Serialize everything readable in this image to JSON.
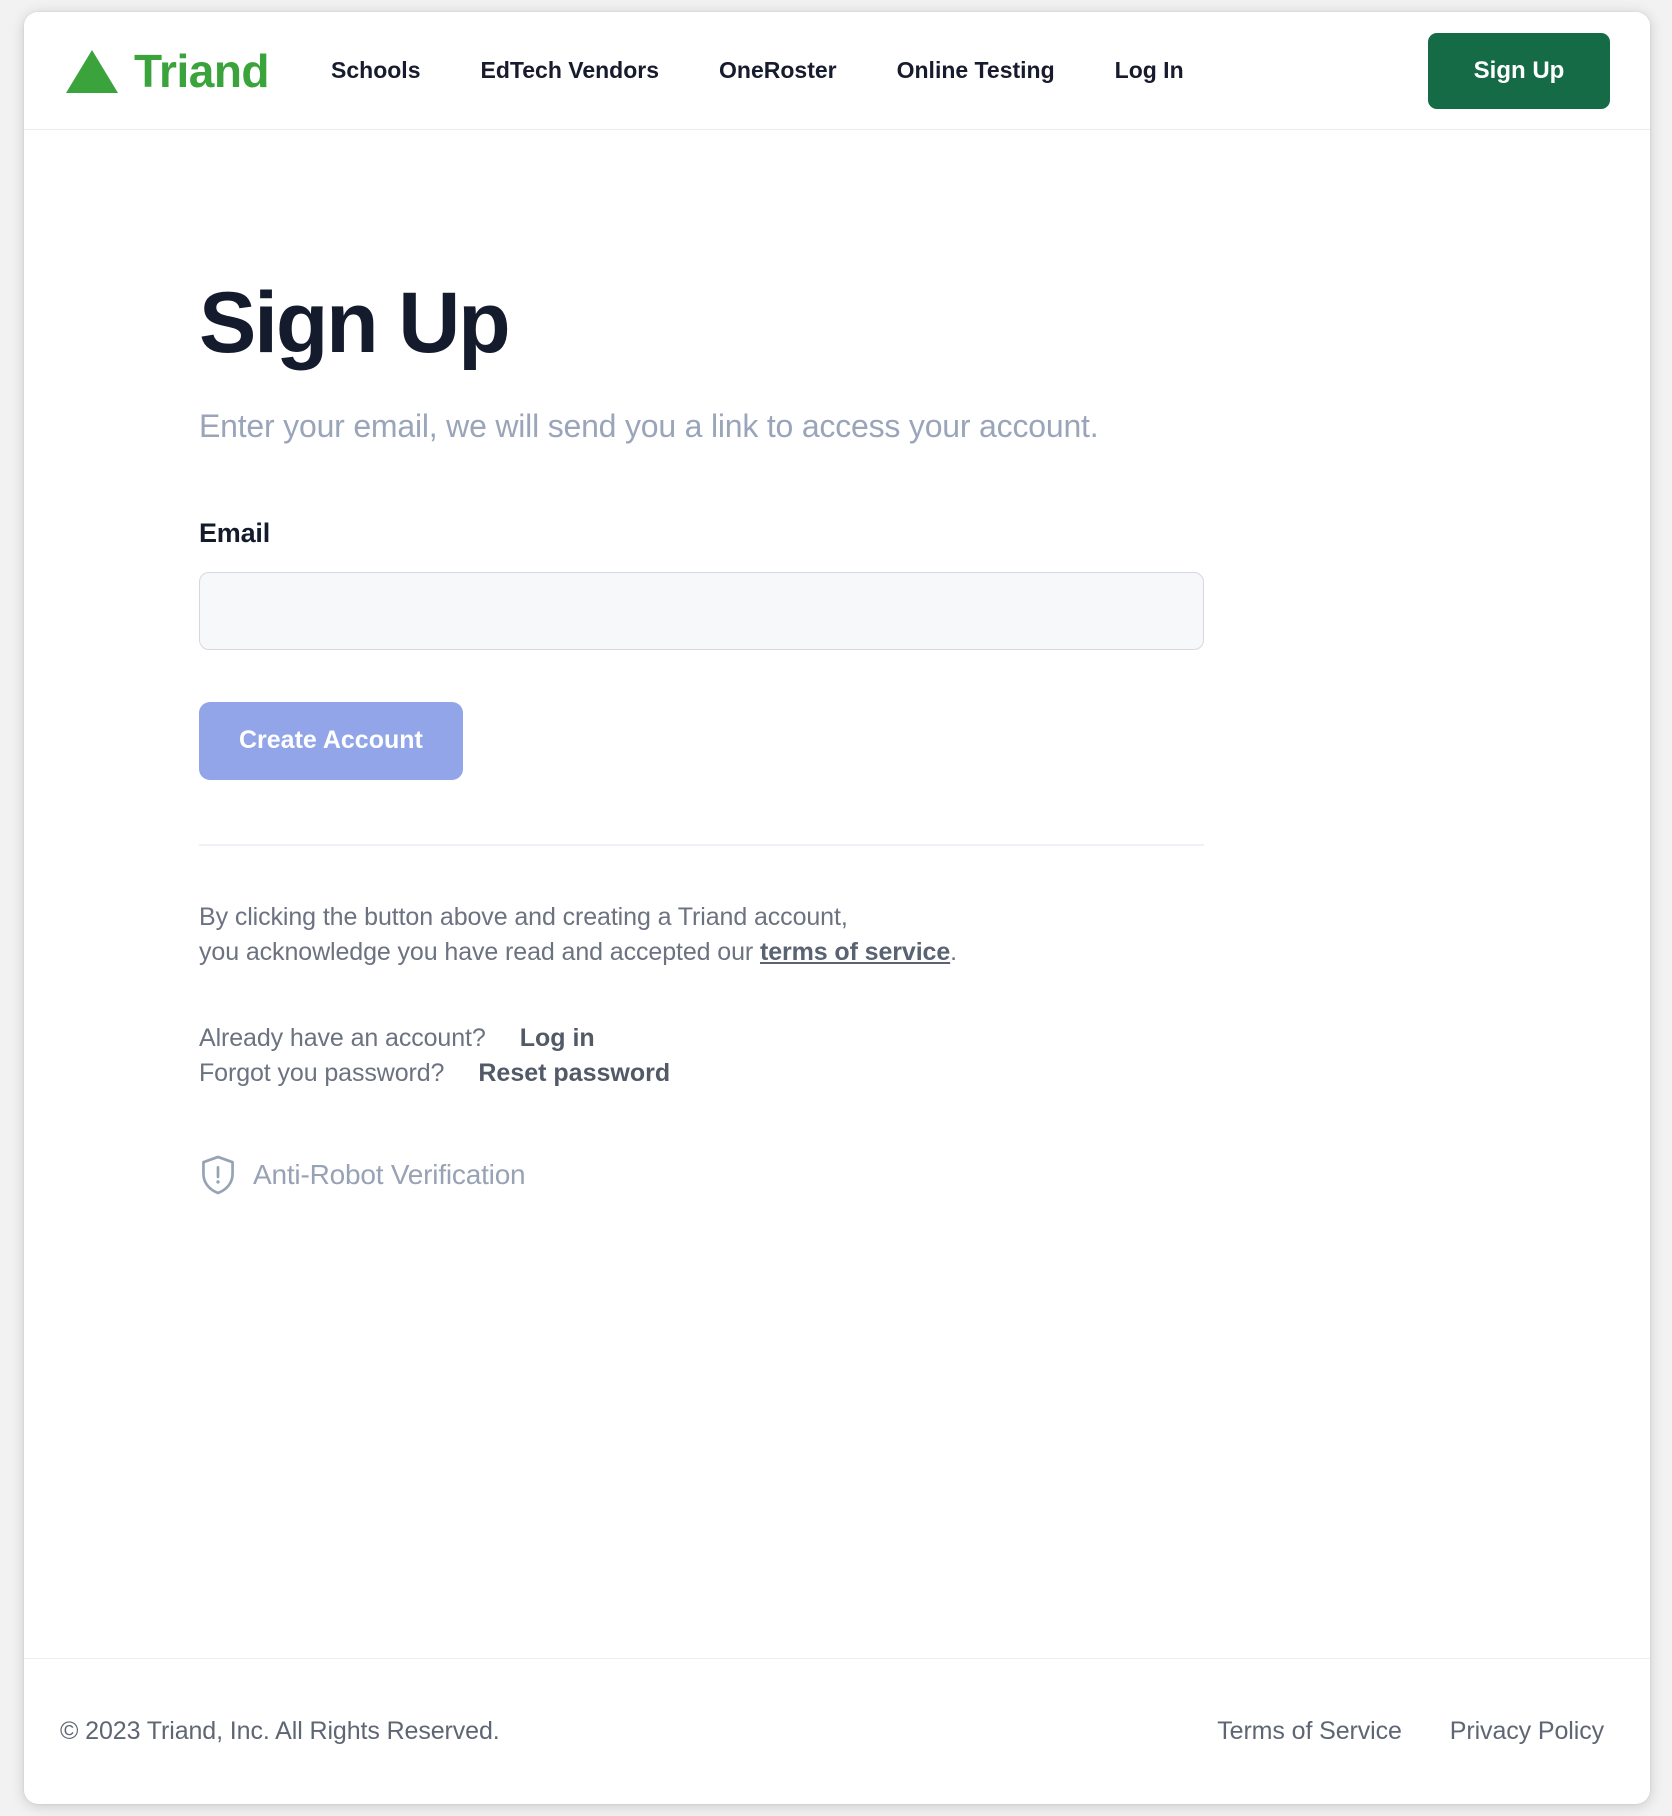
{
  "brand": {
    "name": "Triand",
    "logo_icon": "triangle-icon",
    "logo_color": "#3aa33c",
    "name_color": "#3aa33c"
  },
  "header": {
    "nav": [
      {
        "label": "Schools",
        "name": "nav-link-schools"
      },
      {
        "label": "EdTech Vendors",
        "name": "nav-link-edtech-vendors"
      },
      {
        "label": "OneRoster",
        "name": "nav-link-oneroster"
      },
      {
        "label": "Online Testing",
        "name": "nav-link-online-testing"
      },
      {
        "label": "Log In",
        "name": "nav-link-log-in"
      }
    ],
    "signup_button": {
      "label": "Sign Up",
      "bg_color": "#146b45",
      "text_color": "#ffffff"
    }
  },
  "main": {
    "title": "Sign Up",
    "subtitle": "Enter your email, we will send you a link to access your account.",
    "email_label": "Email",
    "email_value": "",
    "email_placeholder": "",
    "create_button": {
      "label": "Create Account",
      "bg_color": "#92a5e8",
      "text_color": "#ffffff"
    },
    "terms": {
      "line1": "By clicking the button above and creating a Triand account,",
      "line2_prefix": "you acknowledge you have read and accepted our ",
      "link_label": "terms of service",
      "line2_suffix": "."
    },
    "account_rows": [
      {
        "prompt": "Already have an account?",
        "action": "Log in",
        "name": "log-in-link"
      },
      {
        "prompt": "Forgot you password?",
        "action": "Reset password",
        "name": "reset-password-link"
      }
    ],
    "anti_robot": {
      "label": "Anti-Robot Verification",
      "icon": "shield-exclamation-icon",
      "color": "#97a2b4"
    }
  },
  "footer": {
    "copyright": "© 2023  Triand, Inc. All Rights Reserved.",
    "links": [
      {
        "label": "Terms of Service",
        "name": "footer-link-terms-of-service"
      },
      {
        "label": "Privacy Policy",
        "name": "footer-link-privacy-policy"
      }
    ]
  }
}
